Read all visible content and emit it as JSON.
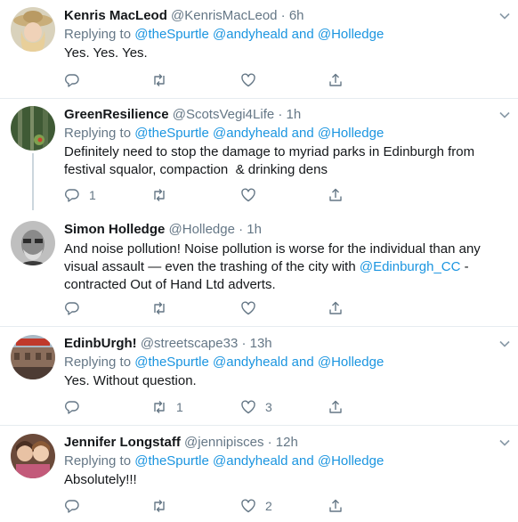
{
  "tweets": [
    {
      "name": "Kenris MacLeod",
      "handle": "@KenrisMacLeod",
      "time": "6h",
      "replying_prefix": "Replying to ",
      "replying_to": [
        "@theSpurtle",
        "@andyheald",
        "@Holledge"
      ],
      "and_word": "and",
      "text": "Yes. Yes. Yes.",
      "reply_count": "",
      "retweet_count": "",
      "like_count": ""
    },
    {
      "name": "GreenResilience",
      "handle": "@ScotsVegi4Life",
      "time": "1h",
      "replying_prefix": "Replying to ",
      "replying_to": [
        "@theSpurtle",
        "@andyheald",
        "@Holledge"
      ],
      "and_word": "and",
      "text_lines": [
        "Definitely need to stop the damage to myriad parks in Edinburgh from",
        "festival squalor, compaction  & drinking dens"
      ],
      "reply_count": "1",
      "retweet_count": "",
      "like_count": ""
    },
    {
      "name": "Simon Holledge",
      "handle": "@Holledge",
      "time": "1h",
      "text_line1": "And noise pollution! Noise pollution is worse for the individual than any",
      "text_line2_pre": "visual assault — even the trashing of the city with ",
      "text_line2_link": "@Edinburgh_CC",
      "text_line2_post": " -",
      "text_line3": "contracted Out of Hand Ltd adverts.",
      "reply_count": "",
      "retweet_count": "",
      "like_count": ""
    },
    {
      "name": "EdinbUrgh!",
      "handle": "@streetscape33",
      "time": "13h",
      "replying_prefix": "Replying to ",
      "replying_to": [
        "@theSpurtle",
        "@andyheald",
        "@Holledge"
      ],
      "and_word": "and",
      "text": "Yes. Without question.",
      "reply_count": "",
      "retweet_count": "1",
      "like_count": "3"
    },
    {
      "name": "Jennifer Longstaff",
      "handle": "@jennipisces",
      "time": "12h",
      "replying_prefix": "Replying to ",
      "replying_to": [
        "@theSpurtle",
        "@andyheald",
        "@Holledge"
      ],
      "and_word": "and",
      "text": "Absolutely!!!",
      "reply_count": "",
      "retweet_count": "",
      "like_count": "2"
    }
  ],
  "separator": "·",
  "colors": {
    "link": "#1b95e0",
    "secondary": "#657786",
    "divider": "#e6ecf0"
  },
  "icons": [
    "reply-icon",
    "retweet-icon",
    "like-icon",
    "share-icon",
    "chevron-down-icon"
  ]
}
